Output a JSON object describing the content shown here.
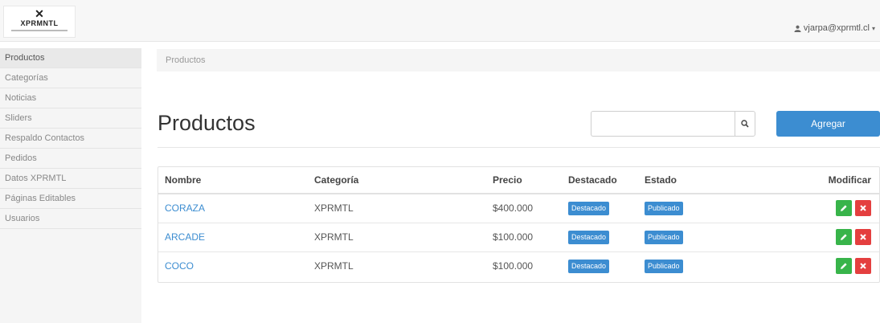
{
  "header": {
    "logo_mark": "✕",
    "logo_text": "XPRMNTL",
    "user_email": "vjarpa@xprmtl.cl",
    "user_icon": "user-icon",
    "caret_icon": "caret-down-icon"
  },
  "sidebar": {
    "items": [
      {
        "label": "Productos",
        "active": true
      },
      {
        "label": "Categorías"
      },
      {
        "label": "Noticias"
      },
      {
        "label": "Sliders"
      },
      {
        "label": "Respaldo Contactos"
      },
      {
        "label": "Pedidos"
      },
      {
        "label": "Datos XPRMTL"
      },
      {
        "label": "Páginas Editables"
      },
      {
        "label": "Usuarios"
      }
    ]
  },
  "breadcrumb": "Productos",
  "page": {
    "title": "Productos",
    "search_placeholder": "",
    "search_icon": "search-icon",
    "add_label": "Agregar"
  },
  "table": {
    "headers": [
      "Nombre",
      "Categoría",
      "Precio",
      "Destacado",
      "Estado",
      "Modificar"
    ],
    "rows": [
      {
        "nombre": "CORAZA",
        "categoria": "XPRMTL",
        "precio": "$400.000",
        "destacado": "Destacado",
        "estado": "Publicado"
      },
      {
        "nombre": "ARCADE",
        "categoria": "XPRMTL",
        "precio": "$100.000",
        "destacado": "Destacado",
        "estado": "Publicado"
      },
      {
        "nombre": "COCO",
        "categoria": "XPRMTL",
        "precio": "$100.000",
        "destacado": "Destacado",
        "estado": "Publicado"
      }
    ]
  },
  "colors": {
    "accent": "#3c8dd1",
    "edit": "#38b44a",
    "delete": "#e43f3f"
  }
}
